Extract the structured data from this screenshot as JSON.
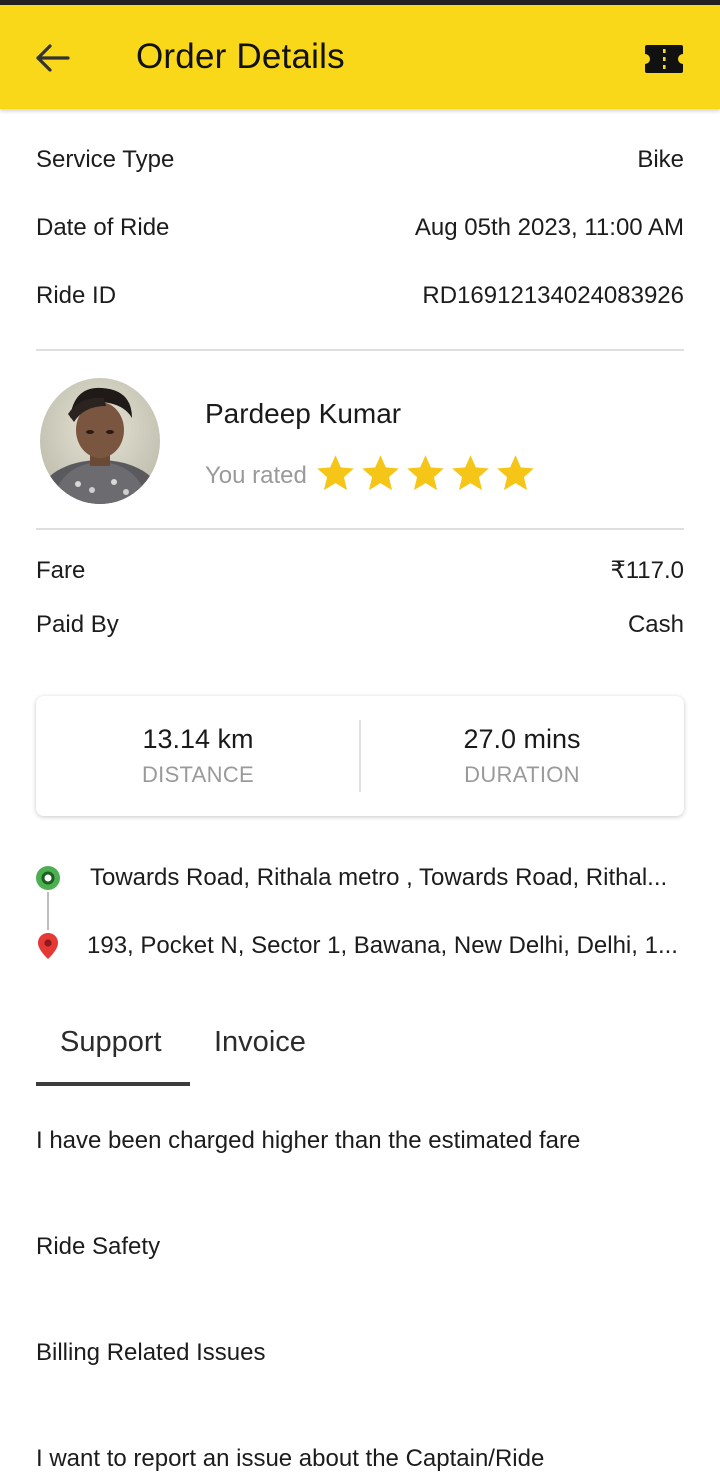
{
  "header": {
    "title": "Order Details",
    "back_icon": "arrow-left-icon",
    "ticket_icon": "ticket-icon",
    "bg_color": "#f8d818"
  },
  "ride_info": {
    "service_type_label": "Service Type",
    "service_type_value": "Bike",
    "date_label": "Date of Ride",
    "date_value": "Aug 05th 2023, 11:00 AM",
    "ride_id_label": "Ride ID",
    "ride_id_value": "RD16912134024083926"
  },
  "captain": {
    "name": "Pardeep Kumar",
    "rated_label": "You rated",
    "rating": 5,
    "star_color": "#f5c518"
  },
  "payment": {
    "fare_label": "Fare",
    "fare_value": "₹117.0",
    "paid_by_label": "Paid By",
    "paid_by_value": "Cash"
  },
  "stats": {
    "distance_value": "13.14 km",
    "distance_label": "DISTANCE",
    "duration_value": "27.0 mins",
    "duration_label": "DURATION"
  },
  "route": {
    "pickup": "Towards Road, Rithala metro , Towards Road, Rithal...",
    "drop": "193, Pocket N, Sector 1, Bawana, New Delhi, Delhi, 1...",
    "pickup_color": "#4caf50",
    "drop_color": "#e53935"
  },
  "tabs": [
    {
      "label": "Support",
      "active": true
    },
    {
      "label": "Invoice",
      "active": false
    }
  ],
  "support_issues": [
    "I have been charged higher than the estimated fare",
    "Ride Safety",
    "Billing Related Issues",
    "I want to report an issue about the Captain/Ride"
  ]
}
